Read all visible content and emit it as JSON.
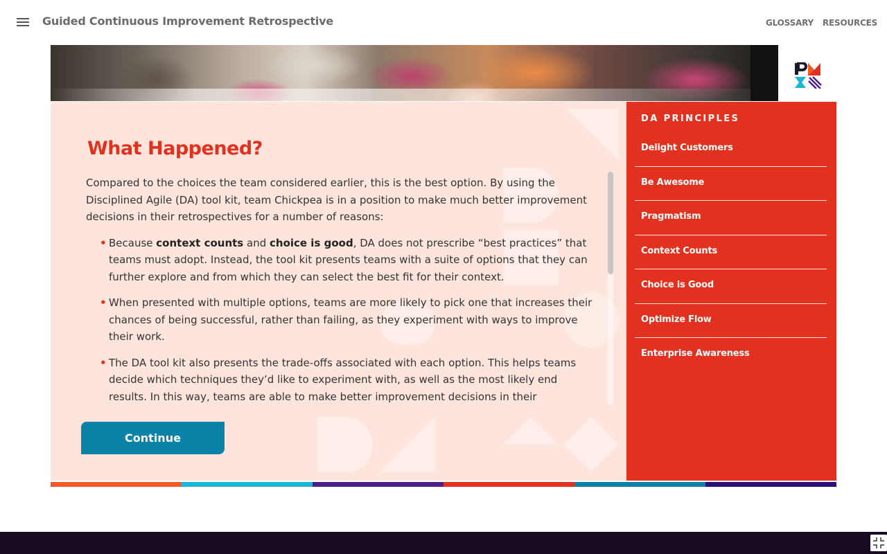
{
  "header": {
    "title": "Guided Continuous Improvement Retrospective",
    "nav": {
      "glossary": "GLOSSARY",
      "resources": "RESOURCES"
    }
  },
  "logo": {
    "icon": "pmi-logo-icon"
  },
  "main": {
    "heading": "What Happened?",
    "intro": "Compared to the choices the team considered earlier, this is the best option. By using the Disciplined Agile (DA) tool kit, team Chickpea is in a position to make much better improvement decisions in their retrospectives for a number of reasons:",
    "bullets": [
      {
        "pre": "Because ",
        "bold1": "context counts",
        "mid": " and ",
        "bold2": "choice is good",
        "post": ", DA does not prescribe “best practices” that teams must adopt. Instead, the tool kit presents teams with a suite of options that they can further explore and from which they can select the best fit for their context."
      },
      {
        "text": "When presented with multiple options, teams are more likely to pick one that increases their chances of being successful, rather than failing, as they experiment with ways to improve their work."
      },
      {
        "text": "The DA tool kit also presents the trade-offs associated with each option. This helps teams decide which techniques they’d like to experiment with, as well as the most likely end results. In this way, teams are able to make better improvement decisions in their retrospectives."
      }
    ],
    "continue_label": "Continue",
    "scroll_position": 0.0
  },
  "sidebar": {
    "title": "DA PRINCIPLES",
    "items": [
      "Delight Customers",
      "Be Awesome",
      "Pragmatism",
      "Context Counts",
      "Choice is Good",
      "Optimize Flow",
      "Enterprise Awareness"
    ]
  },
  "colors": {
    "accent_red": "#e2321f",
    "heading_red": "#e0321e",
    "button_blue": "#0b82a8",
    "panel_bg": "#fde4dc",
    "footer_bg": "#180b22",
    "stripe": [
      "#f05a28",
      "#1bb5d6",
      "#4b1e8c",
      "#e2321f",
      "#0b82a8",
      "#2a117a"
    ]
  },
  "footer": {
    "fullscreen_icon": "exit-fullscreen-icon"
  }
}
